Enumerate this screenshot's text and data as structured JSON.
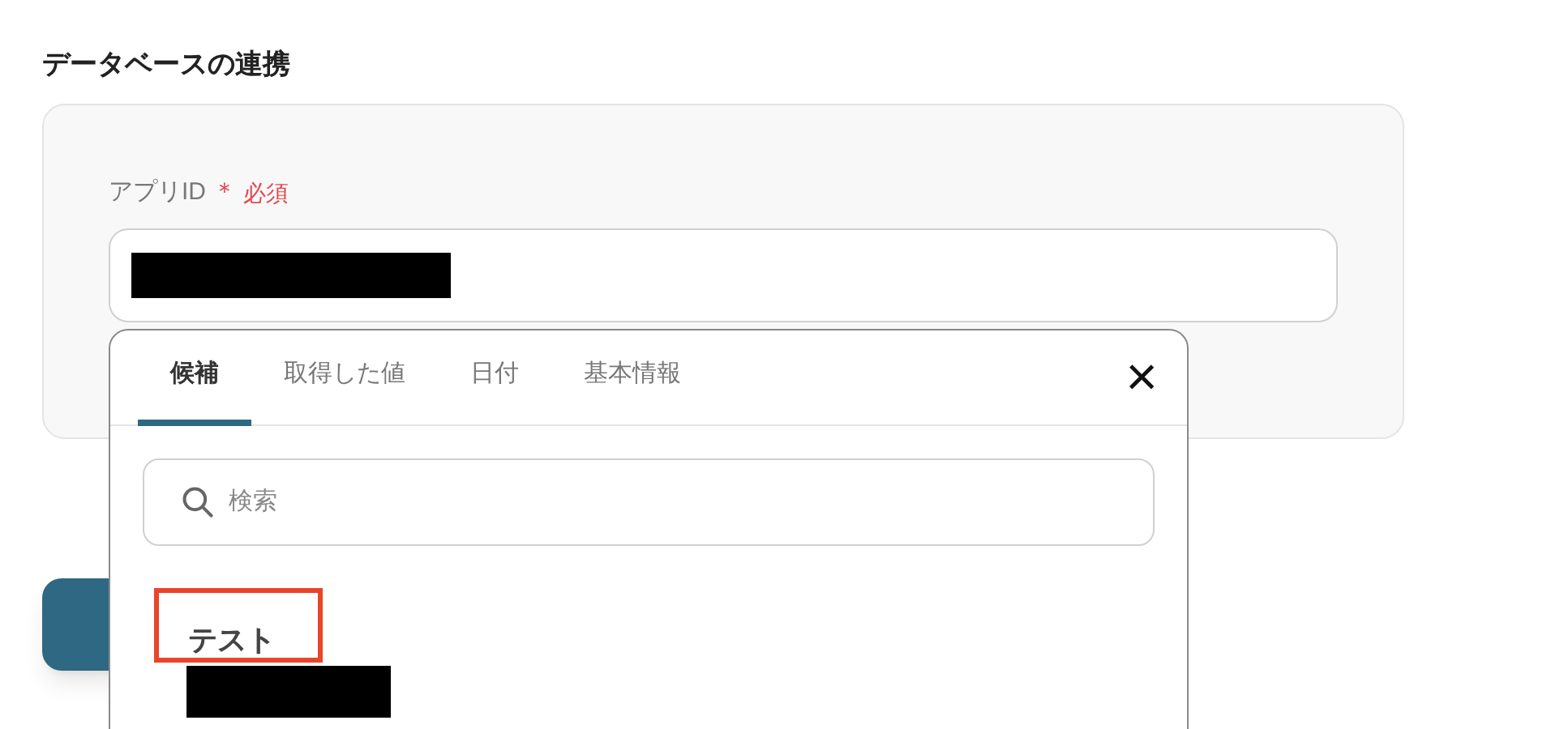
{
  "section": {
    "title": "データベースの連携"
  },
  "field": {
    "label": "アプリID",
    "required_mark": "＊",
    "required_text": "必須"
  },
  "popover": {
    "tabs": [
      {
        "label": "候補",
        "selected": true
      },
      {
        "label": "取得した値",
        "selected": false
      },
      {
        "label": "日付",
        "selected": false
      },
      {
        "label": "基本情報",
        "selected": false
      }
    ],
    "close": "×",
    "search": {
      "placeholder": "検索"
    },
    "candidates": [
      {
        "label": "テスト",
        "highlighted": true
      }
    ]
  }
}
